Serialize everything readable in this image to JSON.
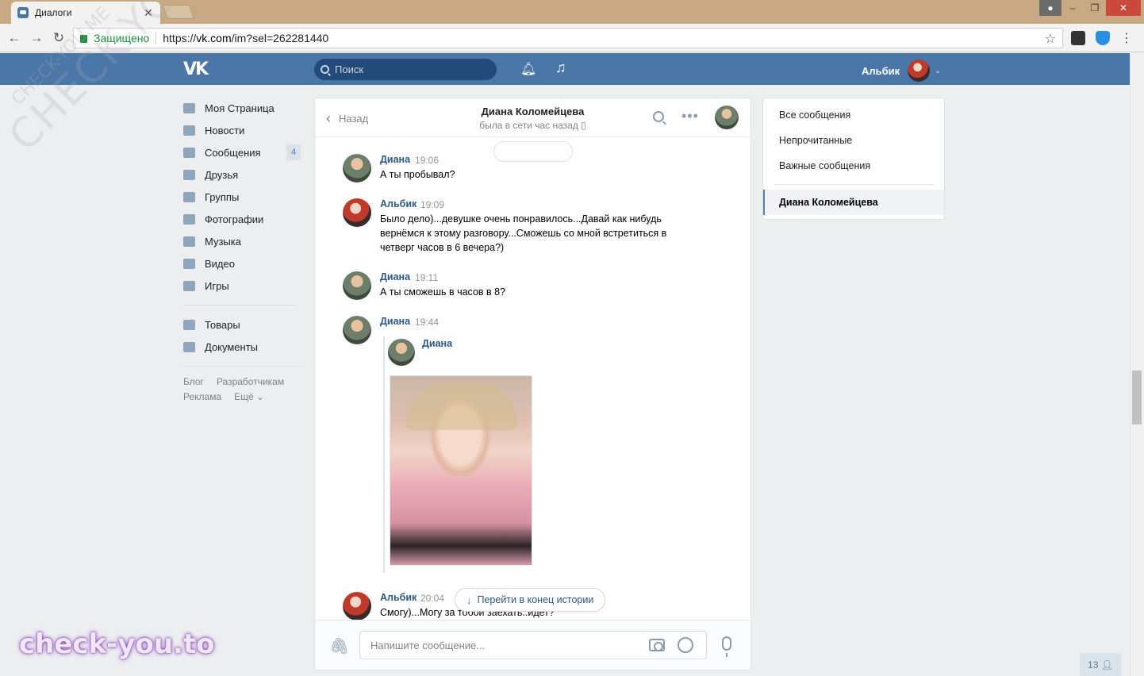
{
  "browser": {
    "tab_title": "Диалоги",
    "secure_label": "Защищено",
    "url_scheme": "https://",
    "url_host": "vk.com",
    "url_path": "/im?sel=262281440"
  },
  "header": {
    "search_placeholder": "Поиск",
    "user_name": "Альбик"
  },
  "sidebar": {
    "items": [
      {
        "label": "Моя Страница",
        "icon": "home-icon"
      },
      {
        "label": "Новости",
        "icon": "news-icon"
      },
      {
        "label": "Сообщения",
        "icon": "messages-icon",
        "badge": "4"
      },
      {
        "label": "Друзья",
        "icon": "friends-icon"
      },
      {
        "label": "Группы",
        "icon": "groups-icon"
      },
      {
        "label": "Фотографии",
        "icon": "camera-icon"
      },
      {
        "label": "Музыка",
        "icon": "music-icon"
      },
      {
        "label": "Видео",
        "icon": "video-icon"
      },
      {
        "label": "Игры",
        "icon": "gamepad-icon"
      }
    ],
    "extra_items": [
      {
        "label": "Товары",
        "icon": "shopping-bag-icon"
      },
      {
        "label": "Документы",
        "icon": "document-icon"
      }
    ],
    "footer": [
      "Блог",
      "Разработчикам",
      "Реклама",
      "Ещё ⌄"
    ]
  },
  "chat": {
    "back_label": "Назад",
    "peer_name": "Диана Коломейцева",
    "peer_status": "была в сети час назад",
    "messages": [
      {
        "author": "Диана",
        "time": "19:06",
        "text": "А ты пробывал?"
      },
      {
        "author": "Альбик",
        "time": "19:09",
        "text": "Было дело)...девушке очень понравилось...Давай как нибудь вернёмся к этому разговору...Сможешь со мной встретиться в четверг часов в 6 вечера?)"
      },
      {
        "author": "Диана",
        "time": "19:11",
        "text": "А ты сможешь в часов в 8?"
      },
      {
        "author": "Диана",
        "time": "19:44",
        "text": ""
      },
      {
        "author": "Альбик",
        "time": "20:04",
        "text": "Смогу)...Могу за тобой заехать..идет?"
      }
    ],
    "forwarded_author": "Диана",
    "jump_label": "Перейти в конец истории",
    "compose_placeholder": "Напишите сообщение..."
  },
  "filters": {
    "all": "Все сообщения",
    "unread": "Непрочитанные",
    "important": "Важные сообщения",
    "active_dialog": "Диана Коломейцева"
  },
  "online_count": "13",
  "watermarks": {
    "diagonal": "CHECK-YOU.ME",
    "small": "CHECK-YOU.ME",
    "brand": "check-you.to"
  },
  "colors": {
    "vk_blue": "#4a76a8",
    "link": "#2a5885",
    "page_bg": "#edeef0"
  }
}
